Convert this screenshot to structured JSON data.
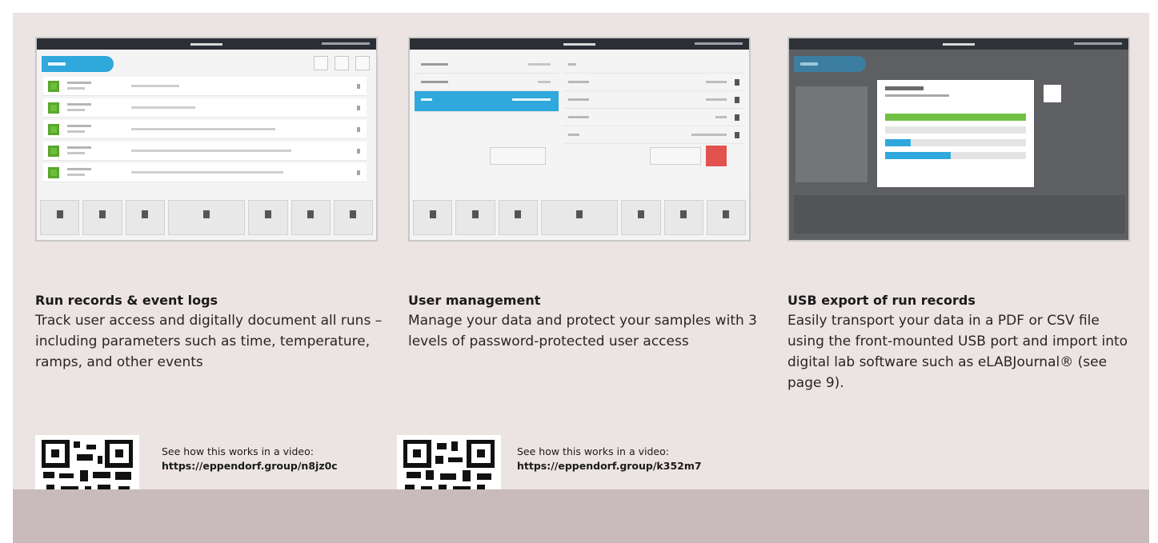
{
  "features": [
    {
      "title": "Run records & event logs",
      "description": "Track user access and digitally document all runs – including parameters such as time, temperature, ramps, and other events",
      "video_prompt": "See how this works in a video:",
      "video_url": "https://eppendorf.group/n8jz0c"
    },
    {
      "title": "User management",
      "description": "Manage your data and protect your samples with 3 levels of password-protected user access",
      "video_prompt": "See how this works in a video:",
      "video_url": "https://eppendorf.group/k352m7"
    },
    {
      "title": "USB export of run records",
      "description": "Easily transport your data in a PDF or CSV file using the front-mounted USB port and import into digital lab software such as eLABJournal® (see page 9)."
    }
  ],
  "colors": {
    "panel_bg": "#ece4e3",
    "bottom_band": "#c9bbbb",
    "accent_blue": "#2fa8dc",
    "status_green": "#6bbf3a",
    "delete_red": "#e2534f"
  }
}
